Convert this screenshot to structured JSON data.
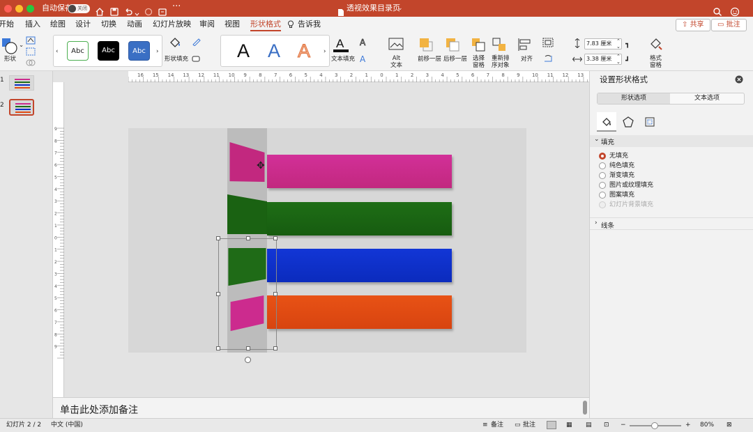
{
  "titlebar": {
    "autosave_label": "自动保存",
    "autosave_state": "关闭",
    "doc_title": "透视效果目录页",
    "color": "#c2452b"
  },
  "tabs": [
    "开始",
    "插入",
    "绘图",
    "设计",
    "切换",
    "动画",
    "幻灯片放映",
    "审阅",
    "视图",
    "形状格式",
    "告诉我"
  ],
  "active_tab": "形状格式",
  "share": {
    "share_label": "共享",
    "comment_label": "批注"
  },
  "ribbon": {
    "shape_label": "形状",
    "style_samples": [
      "Abc",
      "Abc",
      "Abc"
    ],
    "shape_fill_label": "形状填充",
    "wordart_samples": [
      "A",
      "A",
      "A"
    ],
    "text_fill_label": "文本填充",
    "alt_label": "Alt\n文本",
    "bring_forward_label": "前移一层",
    "send_backward_label": "后移一层",
    "select_pane_label": "选择\n窗格",
    "reorder_label": "重新排\n序对象",
    "align_label": "对齐",
    "height_value": "7.83 厘米",
    "width_value": "3.38 厘米",
    "format_pane_label": "格式\n窗格"
  },
  "slides": [
    {
      "number": "1"
    },
    {
      "number": "2"
    }
  ],
  "ruler_labels": [
    "16",
    "15",
    "14",
    "13",
    "12",
    "11",
    "10",
    "9",
    "8",
    "7",
    "6",
    "5",
    "4",
    "3",
    "2",
    "1",
    "0",
    "1",
    "2",
    "3",
    "4",
    "5",
    "6",
    "7",
    "8",
    "9",
    "10",
    "11",
    "12",
    "13",
    "14",
    "15",
    "16"
  ],
  "vruler_labels": [
    "9",
    "8",
    "7",
    "6",
    "5",
    "4",
    "3",
    "2",
    "1",
    "0",
    "1",
    "2",
    "3",
    "4",
    "5",
    "6",
    "7",
    "8",
    "9"
  ],
  "slide_bars": [
    {
      "color": "#cc2b8e",
      "left": "#c2287f"
    },
    {
      "color": "#1f6b17",
      "left": "#1a6212"
    },
    {
      "color": "#0d2fc9",
      "left": "#1f6b17"
    },
    {
      "color": "#e04a12",
      "left": "#cc2b8e"
    }
  ],
  "notes_placeholder": "单击此处添加备注",
  "status": {
    "slide_counter": "幻灯片 2 / 2",
    "language": "中文 (中国)",
    "notes_label": "备注",
    "comments_label": "批注",
    "zoom": "80%",
    "zoom_level": 0.48
  },
  "panel": {
    "title": "设置形状格式",
    "tab_shape": "形状选项",
    "tab_text": "文本选项",
    "fill_section": "填充",
    "fill_options": [
      "无填充",
      "纯色填充",
      "渐变填充",
      "图片或纹理填充",
      "图案填充",
      "幻灯片背景填充"
    ],
    "selected_fill": 0,
    "line_section": "线条"
  }
}
